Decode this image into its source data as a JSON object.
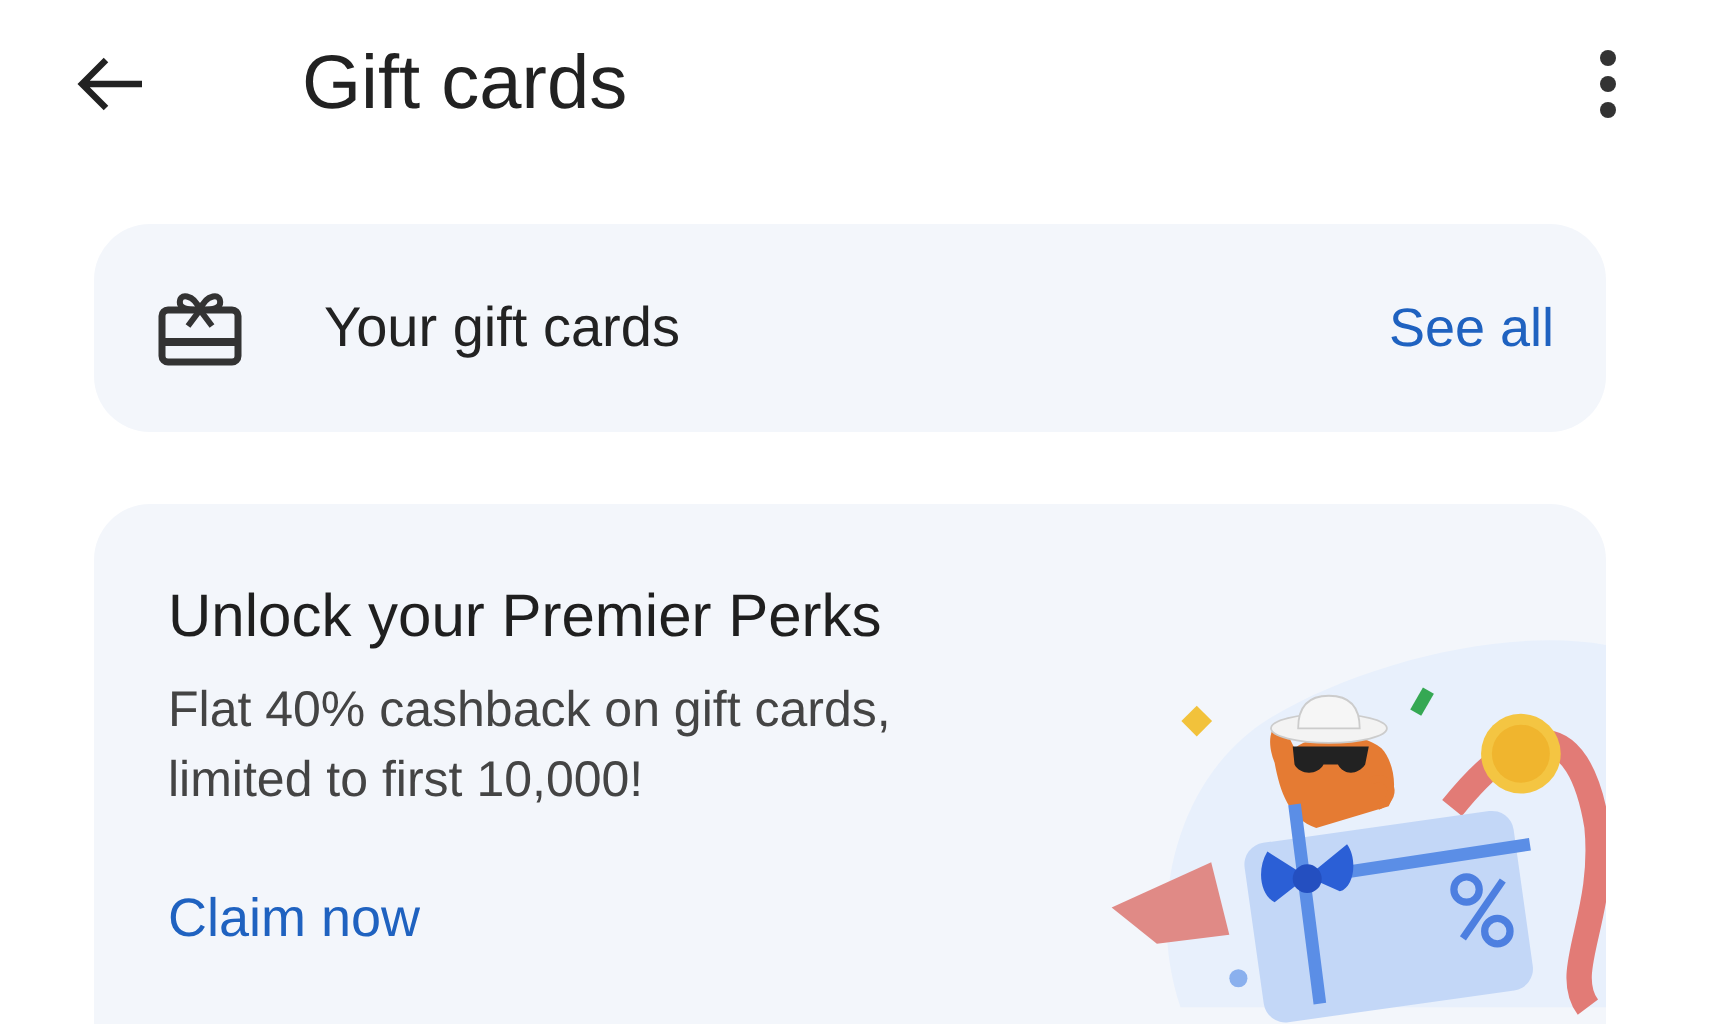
{
  "app_bar": {
    "title": "Gift cards"
  },
  "gift_cards_row": {
    "label": "Your gift cards",
    "action": "See all"
  },
  "promo": {
    "title": "Unlock your Premier Perks",
    "description": "Flat 40% cashback on gift cards, limited to first 10,000!",
    "action": "Claim now"
  }
}
